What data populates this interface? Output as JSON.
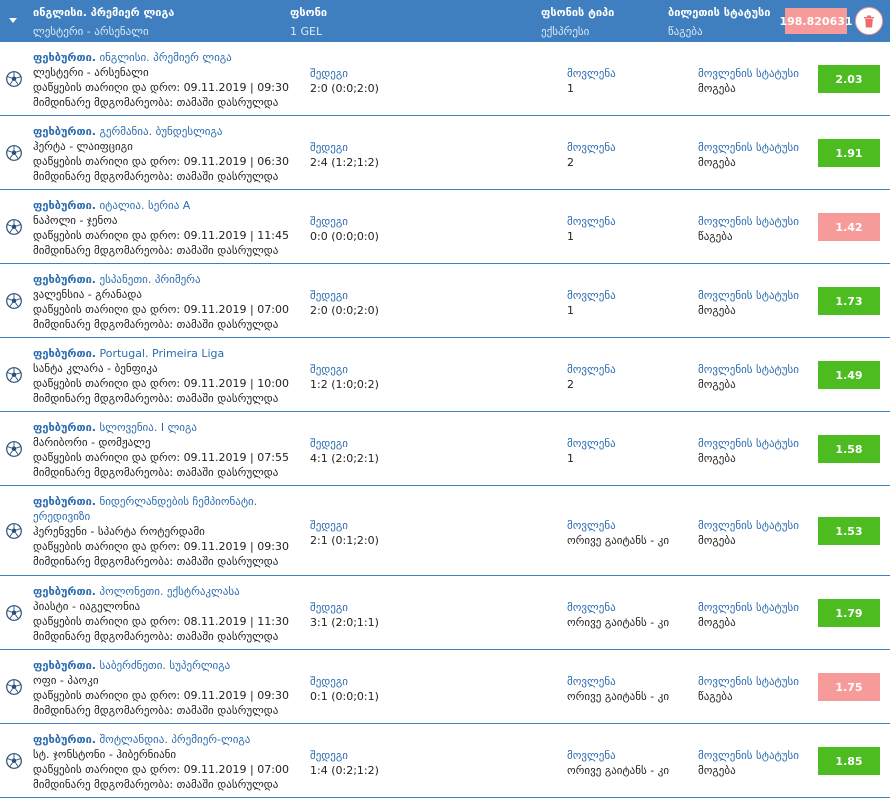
{
  "header": {
    "event_title": "ინგლისი. პრემიერ ლიგა",
    "event_sub": "ლესტერი - არსენალი",
    "stake_title": "ფსონი",
    "stake_value": "1 GEL",
    "type_title": "ფსონის ტიპი",
    "type_value": "ექსპრესი",
    "status_title": "ბილეთის სტატუსი",
    "status_value": "წაგება",
    "total": "198.820631"
  },
  "labels": {
    "sport": "ფეხბურთი.",
    "date_prefix": "დაწყების თარიღი და დრო:",
    "state_prefix": "მიმდინარე მდგომარეობა:",
    "state_value": "თამაში დასრულდა",
    "score_label": "შედეგი",
    "market_label": "მოვლენა",
    "status_label": "მოვლენის სტატუსი"
  },
  "colors": {
    "header_bg": "#3f7fbf",
    "win": "#4cbc21",
    "lose": "#f79a9a",
    "link": "#2b6cb0"
  },
  "bets": [
    {
      "league": "ინგლისი. პრემიერ ლიგა",
      "teams": "ლესტერი - არსენალი",
      "date": "09.11.2019 | 09:30",
      "score": "2:0 (0:0;2:0)",
      "pick": "1",
      "status": "მოგება",
      "odds": "2.03",
      "result": "win"
    },
    {
      "league": "გერმანია. ბუნდესლიგა",
      "teams": "ჰერტა - ლაიფციგი",
      "date": "09.11.2019 | 06:30",
      "score": "2:4 (1:2;1:2)",
      "pick": "2",
      "status": "მოგება",
      "odds": "1.91",
      "result": "win"
    },
    {
      "league": "იტალია. სერია A",
      "teams": "ნაპოლი - ჯენოა",
      "date": "09.11.2019 | 11:45",
      "score": "0:0 (0:0;0:0)",
      "pick": "1",
      "status": "წაგება",
      "odds": "1.42",
      "result": "lose"
    },
    {
      "league": "ესპანეთი. პრიმერა",
      "teams": "ვალენსია - გრანადა",
      "date": "09.11.2019 | 07:00",
      "score": "2:0 (0:0;2:0)",
      "pick": "1",
      "status": "მოგება",
      "odds": "1.73",
      "result": "win"
    },
    {
      "league": "Portugal. Primeira Liga",
      "teams": "სანტა კლარა - ბენფიკა",
      "date": "09.11.2019 | 10:00",
      "score": "1:2 (1:0;0:2)",
      "pick": "2",
      "status": "მოგება",
      "odds": "1.49",
      "result": "win"
    },
    {
      "league": "სლოვენია. I ლიგა",
      "teams": "მარიბორი - დომჟალე",
      "date": "09.11.2019 | 07:55",
      "score": "4:1 (2:0;2:1)",
      "pick": "1",
      "status": "მოგება",
      "odds": "1.58",
      "result": "win"
    },
    {
      "league": "ნიდერლანდების ჩემპიონატი. ერედივიზი",
      "teams": "ჰერენვენი - სპარტა როტერდამი",
      "date": "09.11.2019 | 09:30",
      "score": "2:1 (0:1;2:0)",
      "pick": "ორივე გაიტანს - კი",
      "status": "მოგება",
      "odds": "1.53",
      "result": "win"
    },
    {
      "league": "პოლონეთი. ექსტრაკლასა",
      "teams": "პიასტი - იაგელონია",
      "date": "08.11.2019 | 11:30",
      "score": "3:1 (2:0;1:1)",
      "pick": "ორივე გაიტანს - კი",
      "status": "მოგება",
      "odds": "1.79",
      "result": "win"
    },
    {
      "league": "საბერძნეთი. სუპერლიგა",
      "teams": "ოფი - პაოკი",
      "date": "09.11.2019 | 09:30",
      "score": "0:1 (0:0;0:1)",
      "pick": "ორივე გაიტანს - კი",
      "status": "წაგება",
      "odds": "1.75",
      "result": "lose"
    },
    {
      "league": "შოტლანდია. პრემიერ-ლიგა",
      "teams": "სტ. ჯონსტონი - ჰიბერნიანი",
      "date": "09.11.2019 | 07:00",
      "score": "1:4 (0:2;1:2)",
      "pick": "ორივე გაიტანს - კი",
      "status": "მოგება",
      "odds": "1.85",
      "result": "win"
    }
  ]
}
